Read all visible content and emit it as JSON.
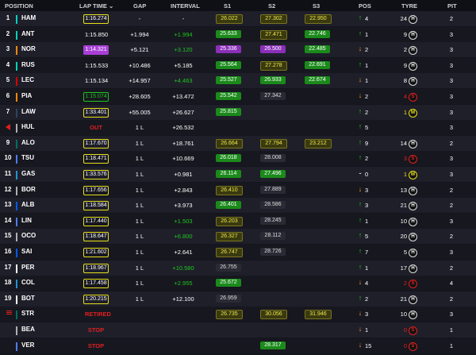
{
  "header": {
    "position": "POSITION",
    "lap_time": "LAP TIME",
    "gap": "GAP",
    "interval": "INTERVAL",
    "s1": "S1",
    "s2": "S2",
    "s3": "S3",
    "pos": "POS",
    "tyre": "TYRE",
    "pit": "PIT"
  },
  "colors": {
    "green": "#1ec71e",
    "purple": "#a83fd6",
    "yellow": "#e8e01a",
    "red": "#e02020",
    "orange": "#f0a020"
  },
  "rows": [
    {
      "pos": "1",
      "driver": "HAM",
      "team": "#00d2be",
      "lap": "1:16.274",
      "lap_style": "yellow",
      "gap": "-",
      "interval": "-",
      "int_style": "",
      "s1": "26.022",
      "s1_style": "yellow",
      "s2": "27.302",
      "s2_style": "yellow",
      "s3": "22.950",
      "s3_style": "yellow",
      "arrow": "up",
      "pos_change": "4",
      "laps": "24",
      "tyre": "H",
      "pit": "2"
    },
    {
      "pos": "2",
      "driver": "ANT",
      "team": "#00d2be",
      "lap": "1:15.850",
      "lap_style": "none",
      "gap": "+1.994",
      "interval": "+1.994",
      "int_style": "green",
      "s1": "25.633",
      "s1_style": "green",
      "s2": "27.471",
      "s2_style": "yellow",
      "s3": "22.746",
      "s3_style": "green",
      "arrow": "up",
      "pos_change": "1",
      "laps": "9",
      "tyre": "H",
      "pit": "3"
    },
    {
      "pos": "3",
      "driver": "NOR",
      "team": "#ff8700",
      "lap": "1:14.321",
      "lap_style": "purple",
      "gap": "+5.121",
      "interval": "+3.120",
      "int_style": "green",
      "s1": "25.336",
      "s1_style": "purple",
      "s2": "26.500",
      "s2_style": "purple",
      "s3": "22.485",
      "s3_style": "green",
      "arrow": "down",
      "pos_change": "2",
      "laps": "2",
      "tyre": "H",
      "pit": "3"
    },
    {
      "pos": "4",
      "driver": "RUS",
      "team": "#00d2be",
      "lap": "1:15.533",
      "lap_style": "none",
      "gap": "+10.486",
      "interval": "+5.185",
      "int_style": "",
      "s1": "25.564",
      "s1_style": "green",
      "s2": "27.278",
      "s2_style": "yellow",
      "s3": "22.691",
      "s3_style": "green",
      "arrow": "up",
      "pos_change": "1",
      "laps": "9",
      "tyre": "H",
      "pit": "3"
    },
    {
      "pos": "5",
      "driver": "LEC",
      "team": "#dc0000",
      "lap": "1:15.134",
      "lap_style": "none",
      "gap": "+14.957",
      "interval": "+4.463",
      "int_style": "green",
      "s1": "25.527",
      "s1_style": "green",
      "s2": "26.933",
      "s2_style": "green",
      "s3": "22.674",
      "s3_style": "green",
      "arrow": "down",
      "pos_change": "1",
      "laps": "8",
      "tyre": "H",
      "pit": "3"
    },
    {
      "pos": "6",
      "driver": "PIA",
      "team": "#ff8700",
      "lap": "1:15.074",
      "lap_style": "green",
      "gap": "+28.605",
      "interval": "+13.472",
      "int_style": "",
      "s1": "25.542",
      "s1_style": "green",
      "s2": "27.342",
      "s2_style": "none",
      "s3": "",
      "s3_style": "none",
      "arrow": "down",
      "pos_change": "2",
      "laps": "4",
      "tyre": "S",
      "pit": "3"
    },
    {
      "pos": "7",
      "driver": "LAW",
      "team": "#2b4562",
      "lap": "1:33.401",
      "lap_style": "yellow",
      "gap": "+55.005",
      "interval": "+26.627",
      "int_style": "",
      "s1": "25.815",
      "s1_style": "green",
      "s2": "",
      "s2_style": "none",
      "s3": "",
      "s3_style": "none",
      "arrow": "up",
      "pos_change": "2",
      "laps": "1",
      "tyre": "M",
      "pit": "3"
    },
    {
      "pos": "",
      "driver": "HUL",
      "team": "#b0b0b0",
      "lap": "OUT",
      "lap_style": "red",
      "gap": "1 L",
      "interval": "+26.532",
      "int_style": "",
      "s1": "",
      "s1_style": "none",
      "s2": "",
      "s2_style": "none",
      "s3": "",
      "s3_style": "none",
      "arrow": "up",
      "pos_change": "5",
      "laps": "",
      "tyre": "",
      "pit": "3",
      "marker": "out"
    },
    {
      "pos": "9",
      "driver": "ALO",
      "team": "#006f62",
      "lap": "1:17.670",
      "lap_style": "yellow",
      "gap": "1 L",
      "interval": "+18.761",
      "int_style": "",
      "s1": "26.664",
      "s1_style": "yellow",
      "s2": "27.794",
      "s2_style": "yellow",
      "s3": "23.212",
      "s3_style": "yellow",
      "arrow": "up",
      "pos_change": "9",
      "laps": "14",
      "tyre": "H",
      "pit": "2"
    },
    {
      "pos": "10",
      "driver": "TSU",
      "team": "#4e7cff",
      "lap": "1:18.471",
      "lap_style": "yellow",
      "gap": "1 L",
      "interval": "+10.669",
      "int_style": "",
      "s1": "26.018",
      "s1_style": "green",
      "s2": "28.008",
      "s2_style": "none",
      "s3": "",
      "s3_style": "none",
      "arrow": "up",
      "pos_change": "2",
      "laps": "3",
      "tyre": "S",
      "pit": "3"
    },
    {
      "pos": "11",
      "driver": "GAS",
      "team": "#2293d1",
      "lap": "1:33.576",
      "lap_style": "yellow",
      "gap": "1 L",
      "interval": "+0.981",
      "int_style": "",
      "s1": "26.114",
      "s1_style": "green",
      "s2": "27.496",
      "s2_style": "green",
      "s3": "",
      "s3_style": "none",
      "arrow": "dash",
      "pos_change": "0",
      "laps": "1",
      "tyre": "M",
      "pit": "3"
    },
    {
      "pos": "12",
      "driver": "BOR",
      "team": "#b0b0b0",
      "lap": "1:17.656",
      "lap_style": "yellow",
      "gap": "1 L",
      "interval": "+2.843",
      "int_style": "",
      "s1": "26.410",
      "s1_style": "yellow",
      "s2": "27.889",
      "s2_style": "none",
      "s3": "",
      "s3_style": "none",
      "arrow": "down",
      "pos_change": "3",
      "laps": "13",
      "tyre": "H",
      "pit": "2"
    },
    {
      "pos": "13",
      "driver": "ALB",
      "team": "#005aff",
      "lap": "1:18.584",
      "lap_style": "yellow",
      "gap": "1 L",
      "interval": "+3.973",
      "int_style": "",
      "s1": "26.401",
      "s1_style": "green",
      "s2": "28.586",
      "s2_style": "none",
      "s3": "",
      "s3_style": "none",
      "arrow": "up",
      "pos_change": "3",
      "laps": "21",
      "tyre": "H",
      "pit": "2"
    },
    {
      "pos": "14",
      "driver": "LIN",
      "team": "#4e7cff",
      "lap": "1:17.440",
      "lap_style": "yellow",
      "gap": "1 L",
      "interval": "+1.503",
      "int_style": "green",
      "s1": "26.203",
      "s1_style": "yellow",
      "s2": "28.245",
      "s2_style": "none",
      "s3": "",
      "s3_style": "none",
      "arrow": "up",
      "pos_change": "1",
      "laps": "10",
      "tyre": "H",
      "pit": "3"
    },
    {
      "pos": "15",
      "driver": "OCO",
      "team": "#b0b0b0",
      "lap": "1:18.647",
      "lap_style": "yellow",
      "gap": "1 L",
      "interval": "+6.800",
      "int_style": "green",
      "s1": "26.327",
      "s1_style": "yellow",
      "s2": "28.112",
      "s2_style": "none",
      "s3": "",
      "s3_style": "none",
      "arrow": "up",
      "pos_change": "5",
      "laps": "20",
      "tyre": "H",
      "pit": "2"
    },
    {
      "pos": "16",
      "driver": "SAI",
      "team": "#005aff",
      "lap": "1:21.602",
      "lap_style": "yellow",
      "gap": "1 L",
      "interval": "+2.641",
      "int_style": "",
      "s1": "26.747",
      "s1_style": "yellow",
      "s2": "28.726",
      "s2_style": "none",
      "s3": "",
      "s3_style": "none",
      "arrow": "up",
      "pos_change": "7",
      "laps": "5",
      "tyre": "H",
      "pit": "3"
    },
    {
      "pos": "17",
      "driver": "PER",
      "team": "#ffffff",
      "lap": "1:18.967",
      "lap_style": "yellow",
      "gap": "1 L",
      "interval": "+10.580",
      "int_style": "green",
      "s1": "26.755",
      "s1_style": "none",
      "s2": "",
      "s2_style": "none",
      "s3": "",
      "s3_style": "none",
      "arrow": "up",
      "pos_change": "1",
      "laps": "17",
      "tyre": "H",
      "pit": "2"
    },
    {
      "pos": "18",
      "driver": "COL",
      "team": "#2293d1",
      "lap": "1:17.458",
      "lap_style": "yellow",
      "gap": "1 L",
      "interval": "+2.955",
      "int_style": "green",
      "s1": "25.672",
      "s1_style": "green",
      "s2": "",
      "s2_style": "none",
      "s3": "",
      "s3_style": "none",
      "arrow": "down",
      "pos_change": "4",
      "laps": "2",
      "tyre": "S",
      "pit": "4"
    },
    {
      "pos": "19",
      "driver": "BOT",
      "team": "#ffffff",
      "lap": "1:20.215",
      "lap_style": "yellow",
      "gap": "1 L",
      "interval": "+12.100",
      "int_style": "",
      "s1": "26.959",
      "s1_style": "none",
      "s2": "",
      "s2_style": "none",
      "s3": "",
      "s3_style": "none",
      "arrow": "up",
      "pos_change": "2",
      "laps": "21",
      "tyre": "H",
      "pit": "2"
    },
    {
      "pos": "",
      "driver": "STR",
      "team": "#006f62",
      "lap": "RETIRED",
      "lap_style": "red",
      "gap": "",
      "interval": "",
      "int_style": "",
      "s1": "26.735",
      "s1_style": "yellow",
      "s2": "30.056",
      "s2_style": "yellow",
      "s3": "31.946",
      "s3_style": "yellow",
      "arrow": "down",
      "pos_change": "3",
      "laps": "10",
      "tyre": "H",
      "pit": "3",
      "marker": "retired"
    },
    {
      "pos": "",
      "driver": "BEA",
      "team": "#b0b0b0",
      "lap": "STOP",
      "lap_style": "red",
      "gap": "",
      "interval": "",
      "int_style": "",
      "s1": "",
      "s1_style": "none",
      "s2": "",
      "s2_style": "none",
      "s3": "",
      "s3_style": "none",
      "arrow": "down",
      "pos_change": "1",
      "laps": "0",
      "tyre": "S",
      "pit": "1"
    },
    {
      "pos": "",
      "driver": "VER",
      "team": "#4e7cff",
      "lap": "STOP",
      "lap_style": "red",
      "gap": "",
      "interval": "",
      "int_style": "",
      "s1": "",
      "s1_style": "none",
      "s2": "28.317",
      "s2_style": "green",
      "s3": "",
      "s3_style": "none",
      "arrow": "down",
      "pos_change": "15",
      "laps": "0",
      "tyre": "S",
      "pit": "1"
    }
  ]
}
